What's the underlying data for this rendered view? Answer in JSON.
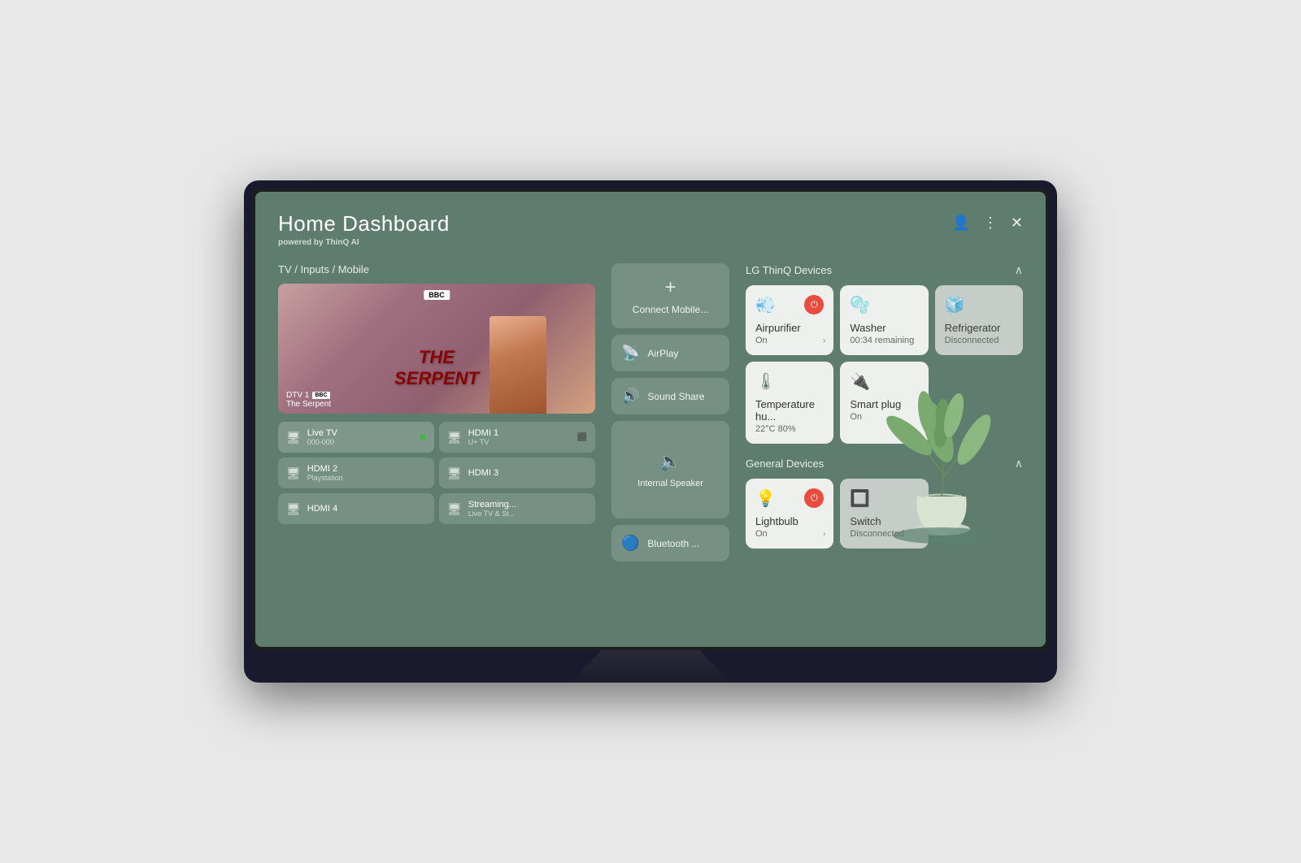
{
  "header": {
    "title": "Home Dashboard",
    "subtitle_prefix": "powered by ",
    "subtitle_brand": "ThinQ AI"
  },
  "tv_inputs": {
    "section_label": "TV / Inputs / Mobile",
    "preview": {
      "channel": "DTV 1",
      "channel_badge": "BBC",
      "show_name": "The Serpent"
    },
    "inputs": [
      {
        "id": "live-tv",
        "name": "Live TV",
        "sub": "000-000",
        "active": true,
        "icon": "🖥"
      },
      {
        "id": "hdmi1",
        "name": "HDMI 1",
        "sub": "U+ TV",
        "active": false,
        "icon": "🖥",
        "has_badge": true
      },
      {
        "id": "hdmi2",
        "name": "HDMI 2",
        "sub": "Playstation",
        "active": false,
        "icon": "🖥"
      },
      {
        "id": "hdmi3",
        "name": "HDMI 3",
        "sub": "",
        "active": false,
        "icon": "🖥"
      },
      {
        "id": "hdmi4",
        "name": "HDMI 4",
        "sub": "",
        "active": false,
        "icon": "🖥"
      },
      {
        "id": "streaming",
        "name": "Streaming...",
        "sub": "Live TV & St...",
        "active": false,
        "icon": "🖥"
      }
    ]
  },
  "actions": [
    {
      "id": "connect-mobile",
      "label": "Connect Mobile...",
      "icon": "+",
      "large": true
    },
    {
      "id": "airplay",
      "label": "AirPlay",
      "icon": "📡"
    },
    {
      "id": "sound-share",
      "label": "Sound Share",
      "icon": "🔊"
    },
    {
      "id": "internal-speaker",
      "label": "Internal Speaker",
      "icon": "🔈",
      "speaker": true
    },
    {
      "id": "bluetooth",
      "label": "Bluetooth ...",
      "icon": "🔵"
    }
  ],
  "thinq_devices": {
    "section_label": "LG ThinQ Devices",
    "devices": [
      {
        "id": "airpurifier",
        "name": "Airpurifier",
        "status": "On",
        "icon": "💨",
        "power": true,
        "disconnected": false,
        "has_chevron": true
      },
      {
        "id": "washer",
        "name": "Washer",
        "status": "00:34 remaining",
        "icon": "🫧",
        "power": false,
        "disconnected": false,
        "has_chevron": false
      },
      {
        "id": "refrigerator",
        "name": "Refrigerator",
        "status": "Disconnected",
        "icon": "🧊",
        "power": false,
        "disconnected": true,
        "has_chevron": false
      },
      {
        "id": "temperature",
        "name": "Temperature hu...",
        "status": "22°C 80%",
        "icon": "🌡",
        "power": false,
        "disconnected": false,
        "has_chevron": false
      },
      {
        "id": "smartplug",
        "name": "Smart plug",
        "status": "On",
        "icon": "🔌",
        "power": false,
        "disconnected": false,
        "has_chevron": false
      }
    ]
  },
  "general_devices": {
    "section_label": "General Devices",
    "devices": [
      {
        "id": "lightbulb",
        "name": "Lightbulb",
        "status": "On",
        "icon": "💡",
        "power": true,
        "disconnected": false,
        "has_chevron": true
      },
      {
        "id": "switch",
        "name": "Switch",
        "status": "Disconnected",
        "icon": "🔲",
        "power": false,
        "disconnected": true,
        "has_chevron": false
      }
    ]
  },
  "icons": {
    "user": "👤",
    "more": "⋮",
    "close": "✕",
    "chevron_up": "∧",
    "chevron_right": "›",
    "power": "⏻"
  }
}
